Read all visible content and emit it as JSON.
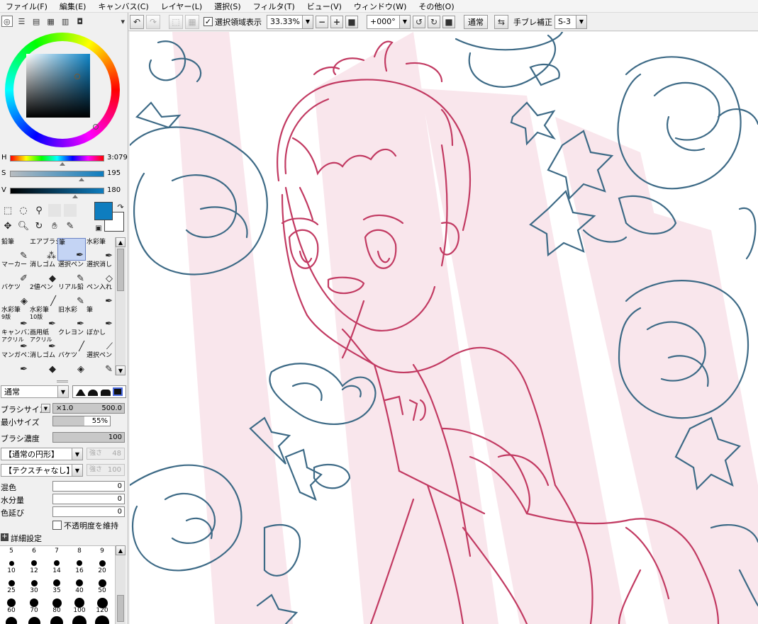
{
  "menu": [
    "ファイル(F)",
    "編集(E)",
    "キャンバス(C)",
    "レイヤー(L)",
    "選択(S)",
    "フィルタ(T)",
    "ビュー(V)",
    "ウィンドウ(W)",
    "その他(O)"
  ],
  "toolbar": {
    "selection_label": "選択領域表示",
    "selection_checked": true,
    "zoom": "33.33%",
    "rotation": "+000°",
    "blend_mode": "通常",
    "stabilizer_label": "手ブレ補正",
    "stabilizer_value": "S-3"
  },
  "color": {
    "h_label": "H",
    "h_value": "3:079",
    "s_label": "S",
    "s_value": "195",
    "v_label": "V",
    "v_value": "180",
    "h_level": 0.95,
    "s_level": 0.78,
    "v_level": 0.71,
    "foreground": "#0e7dbf",
    "background": "#ffffff"
  },
  "tools": [
    "rect-select-icon",
    "lasso-icon",
    "magic-wand-icon",
    "move-icon",
    "zoom-icon",
    "rotate-icon",
    "hand-icon",
    "eyedropper-icon"
  ],
  "brushes": [
    {
      "label": "鉛筆",
      "icon": "pencil-icon"
    },
    {
      "label": "エアブラシ",
      "icon": "airbrush-icon"
    },
    {
      "label": "筆",
      "icon": "brush-icon",
      "active": true
    },
    {
      "label": "水彩筆",
      "icon": "watercolor-icon"
    },
    {
      "label": "マーカー",
      "icon": "marker-icon"
    },
    {
      "label": "消しゴム",
      "icon": "eraser-icon"
    },
    {
      "label": "選択ペン",
      "icon": "selpen-icon"
    },
    {
      "label": "選択消し",
      "icon": "seleraser-icon"
    },
    {
      "label": "バケツ",
      "icon": "bucket-icon"
    },
    {
      "label": "2値ペン",
      "icon": "binarypen-icon"
    },
    {
      "label": "リアル鉛",
      "icon": "realpencil-icon"
    },
    {
      "label": "ペン入れ",
      "icon": "inkpen-icon"
    },
    {
      "label": "水彩筆",
      "label2": "9版",
      "icon": "watercolor-icon"
    },
    {
      "label": "水彩筆",
      "label2": "10版",
      "icon": "watercolor-icon"
    },
    {
      "label": "旧水彩",
      "icon": "oldwater-icon"
    },
    {
      "label": "筆",
      "icon": "brush-icon"
    },
    {
      "label": "キャンバス",
      "label2": "アクリル",
      "icon": "canvasacryl-icon"
    },
    {
      "label": "画用紙",
      "label2": "アクリル",
      "icon": "paperacryl-icon"
    },
    {
      "label": "クレヨン",
      "icon": "crayon-icon"
    },
    {
      "label": "ぼかし",
      "icon": "blur-icon"
    },
    {
      "label": "マンガペン",
      "icon": "mangapen-icon"
    },
    {
      "label": "消しゴム",
      "icon": "eraser-icon"
    },
    {
      "label": "バケツ",
      "icon": "bucket-icon"
    },
    {
      "label": "選択ペン",
      "icon": "selpen-icon"
    }
  ],
  "brush_settings": {
    "mode": "通常",
    "size_label": "ブラシサイズ",
    "size_mult": "×1.0",
    "size_value": "500.0",
    "min_size_label": "最小サイズ",
    "min_size_value": "55%",
    "min_size_level": 0.55,
    "density_label": "ブラシ濃度",
    "density_value": "100",
    "density_level": 1.0,
    "shape": "【通常の円形】",
    "shape_strength_label": "強さ",
    "shape_strength": "48",
    "texture": "【テクスチャなし】",
    "texture_strength_label": "強さ",
    "texture_strength": "100",
    "blend_label": "混色",
    "blend_value": "0",
    "water_label": "水分量",
    "water_value": "0",
    "stretch_label": "色延び",
    "stretch_value": "0",
    "keep_opacity_label": "不透明度を維持",
    "detail_label": "詳細設定"
  },
  "brush_sizes": [
    "5",
    "6",
    "7",
    "8",
    "9",
    "10",
    "12",
    "14",
    "16",
    "20",
    "25",
    "30",
    "35",
    "40",
    "50",
    "60",
    "70",
    "80",
    "100",
    "120"
  ]
}
